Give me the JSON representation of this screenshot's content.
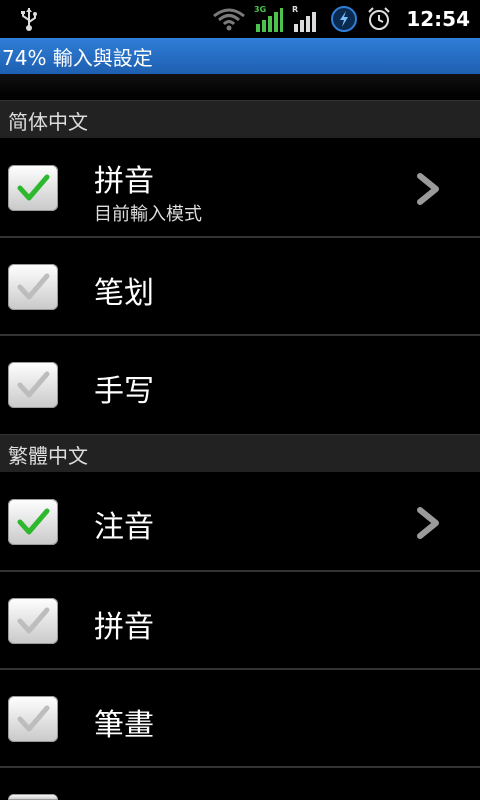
{
  "status": {
    "time": "12:54",
    "icons": [
      "usb-icon",
      "wifi-icon",
      "3g-signal-icon",
      "roaming-signal-icon",
      "sync-icon",
      "alarm-icon"
    ]
  },
  "title": "74% 輸入與設定",
  "sections": {
    "simplified": "简体中文",
    "traditional": "繁體中文"
  },
  "items": [
    {
      "label": "拼音",
      "sub": "目前輸入模式",
      "checked": true
    },
    {
      "label": "笔划",
      "checked": false
    },
    {
      "label": "手写",
      "checked": false
    },
    {
      "label": "注音",
      "checked": true
    },
    {
      "label": "拼音",
      "checked": false
    },
    {
      "label": "筆畫",
      "checked": false
    }
  ],
  "colors": {
    "accent": "#2f7ed8",
    "check_on": "#2db82d",
    "check_off": "#bdbdbd"
  }
}
